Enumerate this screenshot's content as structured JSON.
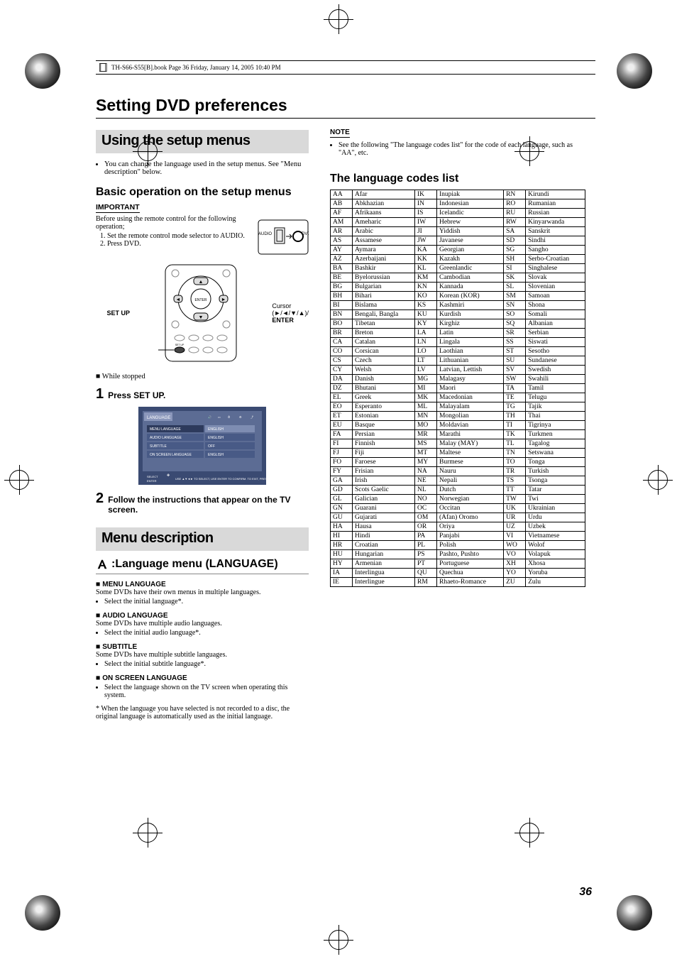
{
  "header": "TH-S66-S55[B].book  Page 36  Friday, January 14, 2005  10:40 PM",
  "title": "Setting DVD preferences",
  "box1": "Using the setup menus",
  "intro_bullet": "You can change the language used in the setup menus. See \"Menu description\" below.",
  "basic_head": "Basic operation on the setup menus",
  "important": "IMPORTANT",
  "important_text": "Before using the remote control for the following operation;",
  "imp1": "Set the remote control mode selector to AUDIO.",
  "imp2": "Press DVD.",
  "fig_setup": "SET UP",
  "fig_cursor": "Cursor",
  "fig_cursor2": "(►/◄/▼/▲)/",
  "fig_enter": "ENTER",
  "while_stopped": "■ While stopped",
  "step1_n": "1",
  "step1_t": "Press SET UP.",
  "step2_n": "2",
  "step2_t": "Follow the instructions that appear on the TV screen.",
  "box2": "Menu description",
  "menu_head": ":Language menu (LANGUAGE)",
  "ml_lbl": "MENU LANGUAGE",
  "ml_txt": "Some DVDs have their own menus in multiple languages.",
  "ml_b": "Select the initial language*.",
  "al_lbl": "AUDIO LANGUAGE",
  "al_txt": "Some DVDs have multiple audio languages.",
  "al_b": "Select the initial audio language*.",
  "st_lbl": "SUBTITLE",
  "st_txt": "Some DVDs have multiple subtitle languages.",
  "st_b": "Select the initial subtitle language*.",
  "os_lbl": "ON SCREEN LANGUAGE",
  "os_b": "Select the language shown on the TV screen when operating this system.",
  "asterisk": "* When the language you have selected is not recorded to a disc, the original language is automatically used as the initial language.",
  "note_lbl": "NOTE",
  "note_txt": "See the following \"The language codes list\" for the code of each language, such as \"AA\", etc.",
  "list_head": "The language codes list",
  "menu_fig": {
    "tab": "LANGUAGE",
    "r1a": "MENU LANGUAGE",
    "r1b": "ENGLISH",
    "r2a": "AUDIO LANGUAGE",
    "r2b": "ENGLISH",
    "r3a": "SUBTITLE",
    "r3b": "OFF",
    "r4a": "ON SCREEN LANGUAGE",
    "r4b": "ENGLISH",
    "hint": "USE ▲▼◄► TO SELECT, USE ENTER TO CONFIRM. TO EXIT, PRESS SET UP.",
    "hint_l1": "SELECT",
    "hint_l2": "ENTER"
  },
  "selector": {
    "audio": "AUDIO",
    "dvd": "DVD"
  },
  "codes": [
    [
      "AA",
      "Afar",
      "IK",
      "Inupiak",
      "RN",
      "Kirundi"
    ],
    [
      "AB",
      "Abkhazian",
      "IN",
      "Indonesian",
      "RO",
      "Rumanian"
    ],
    [
      "AF",
      "Afrikaans",
      "IS",
      "Icelandic",
      "RU",
      "Russian"
    ],
    [
      "AM",
      "Ameharic",
      "IW",
      "Hebrew",
      "RW",
      "Kinyarwanda"
    ],
    [
      "AR",
      "Arabic",
      "JI",
      "Yiddish",
      "SA",
      "Sanskrit"
    ],
    [
      "AS",
      "Assamese",
      "JW",
      "Javanese",
      "SD",
      "Sindhi"
    ],
    [
      "AY",
      "Aymara",
      "KA",
      "Georgian",
      "SG",
      "Sangho"
    ],
    [
      "AZ",
      "Azerbaijani",
      "KK",
      "Kazakh",
      "SH",
      "Serbo-Croatian"
    ],
    [
      "BA",
      "Bashkir",
      "KL",
      "Greenlandic",
      "SI",
      "Singhalese"
    ],
    [
      "BE",
      "Byelorussian",
      "KM",
      "Cambodian",
      "SK",
      "Slovak"
    ],
    [
      "BG",
      "Bulgarian",
      "KN",
      "Kannada",
      "SL",
      "Slovenian"
    ],
    [
      "BH",
      "Bihari",
      "KO",
      "Korean (KOR)",
      "SM",
      "Samoan"
    ],
    [
      "BI",
      "Bislama",
      "KS",
      "Kashmiri",
      "SN",
      "Shona"
    ],
    [
      "BN",
      "Bengali, Bangla",
      "KU",
      "Kurdish",
      "SO",
      "Somali"
    ],
    [
      "BO",
      "Tibetan",
      "KY",
      "Kirghiz",
      "SQ",
      "Albanian"
    ],
    [
      "BR",
      "Breton",
      "LA",
      "Latin",
      "SR",
      "Serbian"
    ],
    [
      "CA",
      "Catalan",
      "LN",
      "Lingala",
      "SS",
      "Siswati"
    ],
    [
      "CO",
      "Corsican",
      "LO",
      "Laothian",
      "ST",
      "Sesotho"
    ],
    [
      "CS",
      "Czech",
      "LT",
      "Lithuanian",
      "SU",
      "Sundanese"
    ],
    [
      "CY",
      "Welsh",
      "LV",
      "Latvian, Lettish",
      "SV",
      "Swedish"
    ],
    [
      "DA",
      "Danish",
      "MG",
      "Malagasy",
      "SW",
      "Swahili"
    ],
    [
      "DZ",
      "Bhutani",
      "MI",
      "Maori",
      "TA",
      "Tamil"
    ],
    [
      "EL",
      "Greek",
      "MK",
      "Macedonian",
      "TE",
      "Telugu"
    ],
    [
      "EO",
      "Esperanto",
      "ML",
      "Malayalam",
      "TG",
      "Tajik"
    ],
    [
      "ET",
      "Estonian",
      "MN",
      "Mongolian",
      "TH",
      "Thai"
    ],
    [
      "EU",
      "Basque",
      "MO",
      "Moldavian",
      "TI",
      "Tigrinya"
    ],
    [
      "FA",
      "Persian",
      "MR",
      "Marathi",
      "TK",
      "Turkmen"
    ],
    [
      "FI",
      "Finnish",
      "MS",
      "Malay (MAY)",
      "TL",
      "Tagalog"
    ],
    [
      "FJ",
      "Fiji",
      "MT",
      "Maltese",
      "TN",
      "Setswana"
    ],
    [
      "FO",
      "Faroese",
      "MY",
      "Burmese",
      "TO",
      "Tonga"
    ],
    [
      "FY",
      "Frisian",
      "NA",
      "Nauru",
      "TR",
      "Turkish"
    ],
    [
      "GA",
      "Irish",
      "NE",
      "Nepali",
      "TS",
      "Tsonga"
    ],
    [
      "GD",
      "Scots Gaelic",
      "NL",
      "Dutch",
      "TT",
      "Tatar"
    ],
    [
      "GL",
      "Galician",
      "NO",
      "Norwegian",
      "TW",
      "Twi"
    ],
    [
      "GN",
      "Guarani",
      "OC",
      "Occitan",
      "UK",
      "Ukrainian"
    ],
    [
      "GU",
      "Gujarati",
      "OM",
      "(Afan) Oromo",
      "UR",
      "Urdu"
    ],
    [
      "HA",
      "Hausa",
      "OR",
      "Oriya",
      "UZ",
      "Uzbek"
    ],
    [
      "HI",
      "Hindi",
      "PA",
      "Panjabi",
      "VI",
      "Vietnamese"
    ],
    [
      "HR",
      "Croatian",
      "PL",
      "Polish",
      "WO",
      "Wolof"
    ],
    [
      "HU",
      "Hungarian",
      "PS",
      "Pashto, Pushto",
      "VO",
      "Volapuk"
    ],
    [
      "HY",
      "Armenian",
      "PT",
      "Portuguese",
      "XH",
      "Xhosa"
    ],
    [
      "IA",
      "Interlingua",
      "QU",
      "Quechua",
      "YO",
      "Yoruba"
    ],
    [
      "IE",
      "Interlingue",
      "RM",
      "Rhaeto-Romance",
      "ZU",
      "Zulu"
    ]
  ],
  "page_num": "36"
}
